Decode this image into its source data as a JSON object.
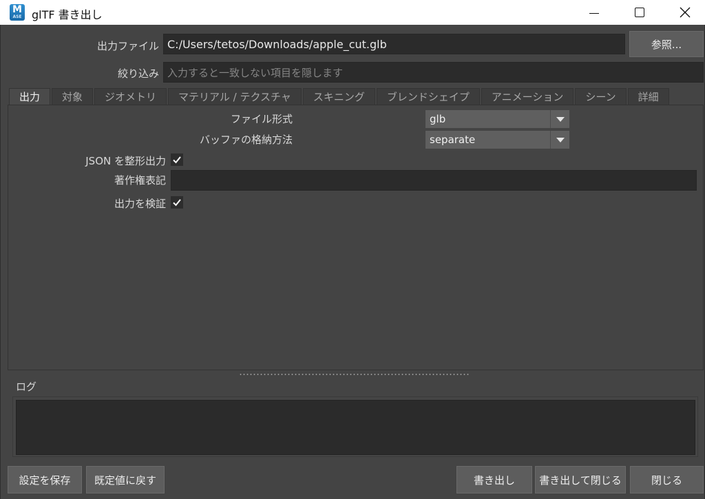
{
  "window": {
    "icon_letter": "M",
    "icon_sub": "ASE",
    "title": "glTF 書き出し"
  },
  "output_file": {
    "label": "出力ファイル",
    "value": "C:/Users/tetos/Downloads/apple_cut.glb",
    "browse_label": "参照..."
  },
  "filter": {
    "label": "絞り込み",
    "placeholder": "入力すると一致しない項目を隠します"
  },
  "tabs": [
    {
      "label": "出力",
      "active": true
    },
    {
      "label": "対象",
      "active": false
    },
    {
      "label": "ジオメトリ",
      "active": false
    },
    {
      "label": "マテリアル / テクスチャ",
      "active": false
    },
    {
      "label": "スキニング",
      "active": false
    },
    {
      "label": "ブレンドシェイプ",
      "active": false
    },
    {
      "label": "アニメーション",
      "active": false
    },
    {
      "label": "シーン",
      "active": false
    },
    {
      "label": "詳細",
      "active": false
    }
  ],
  "output_tab": {
    "file_format": {
      "label": "ファイル形式",
      "value": "glb"
    },
    "buffer_storage": {
      "label": "バッファの格納方法",
      "value": "separate"
    },
    "pretty_json": {
      "label": "JSON を整形出力",
      "checked": true
    },
    "copyright": {
      "label": "著作権表記",
      "value": ""
    },
    "validate_output": {
      "label": "出力を検証",
      "checked": true
    }
  },
  "log": {
    "label": "ログ",
    "content": ""
  },
  "buttons": {
    "save_settings": "設定を保存",
    "reset_defaults": "既定値に戻す",
    "export": "書き出し",
    "export_close": "書き出して閉じる",
    "close": "閉じる"
  }
}
